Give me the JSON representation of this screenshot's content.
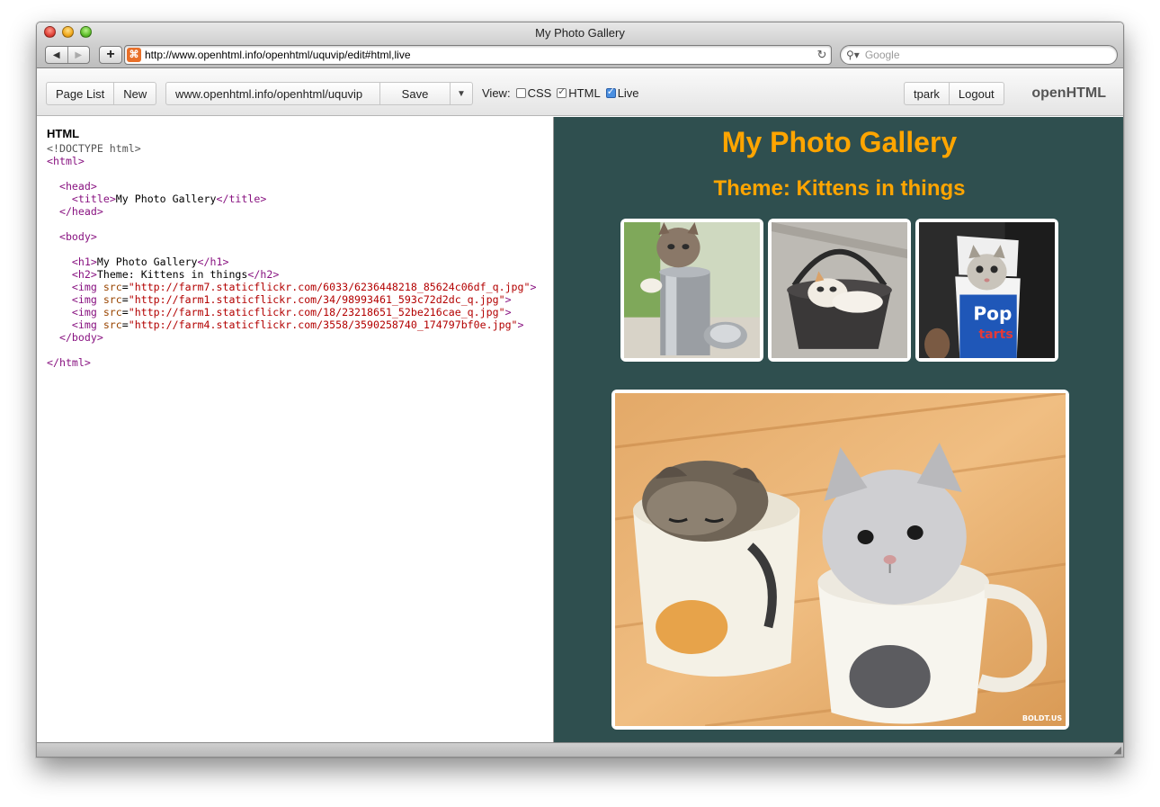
{
  "window": {
    "title": "My Photo Gallery",
    "nav_back": "◀",
    "nav_forward": "▶",
    "add_tab": "+",
    "url": "http://www.openhtml.info/openhtml/uquvip/edit#html,live",
    "search_placeholder": "Google"
  },
  "toolbar": {
    "page_list": "Page List",
    "new": "New",
    "page_url": "www.openhtml.info/openhtml/uquvip",
    "save": "Save",
    "dropdown": "▼",
    "view_label": "View:",
    "view_options": [
      {
        "label": "CSS",
        "checked": false
      },
      {
        "label": "HTML",
        "checked": true
      },
      {
        "label": "Live",
        "checked": true
      }
    ],
    "user": "tpark",
    "logout": "Logout",
    "brand": "openHTML"
  },
  "editor": {
    "title": "HTML",
    "lines": [
      "<!DOCTYPE html>",
      "<html>",
      "",
      "  <head>",
      "    <title>My Photo Gallery</title>",
      "  </head>",
      "",
      "  <body>",
      "",
      "    <h1>My Photo Gallery</h1>",
      "    <h2>Theme: Kittens in things</h2>",
      "    <img src=\"http://farm7.staticflickr.com/6033/6236448218_85624c06df_q.jpg\">",
      "    <img src=\"http://farm1.staticflickr.com/34/98993461_593c72d2dc_q.jpg\">",
      "    <img src=\"http://farm1.staticflickr.com/18/23218651_52be216cae_q.jpg\">",
      "    <img src=\"http://farm4.staticflickr.com/3558/3590258740_174797bf0e.jpg\">",
      "  </body>",
      "",
      "</html>"
    ]
  },
  "preview": {
    "h1": "My Photo Gallery",
    "h2": "Theme: Kittens in things",
    "photo_watermark": "BOLDT.US",
    "background": "#2f4f4f",
    "heading_color": "#ffa500"
  }
}
